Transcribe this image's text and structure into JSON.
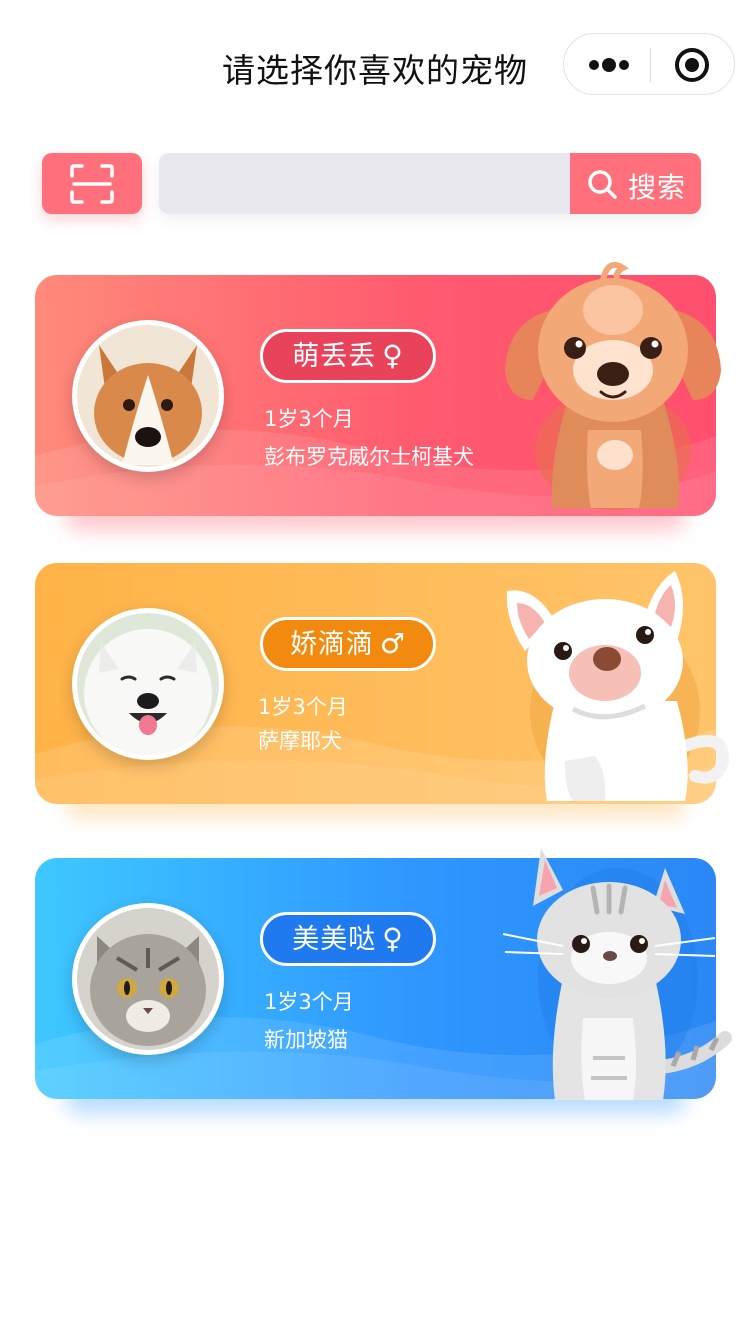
{
  "header": {
    "title": "请选择你喜欢的宠物",
    "more_icon": "more-dots-icon",
    "target_icon": "target-icon"
  },
  "search": {
    "scan_icon": "scan-icon",
    "value": "",
    "placeholder": "",
    "button_label": "搜索",
    "button_icon": "search-icon"
  },
  "pets": [
    {
      "name": "萌丢丢",
      "gender_symbol": "♀",
      "age": "1岁3个月",
      "breed": "彭布罗克威尔士柯基犬",
      "color": "#ff5a6b",
      "pill_bg": "#e8435a",
      "illustration": "cartoon-puppy"
    },
    {
      "name": "娇滴滴",
      "gender_symbol": "♂",
      "age": "1岁3个月",
      "breed": "萨摩耶犬",
      "color": "#ffb44a",
      "pill_bg": "#f28a10",
      "illustration": "cartoon-white-dog"
    },
    {
      "name": "美美哒",
      "gender_symbol": "♀",
      "age": "1岁3个月",
      "breed": "新加坡猫",
      "color": "#2f97ff",
      "pill_bg": "#1f7af0",
      "illustration": "cartoon-cat"
    }
  ]
}
